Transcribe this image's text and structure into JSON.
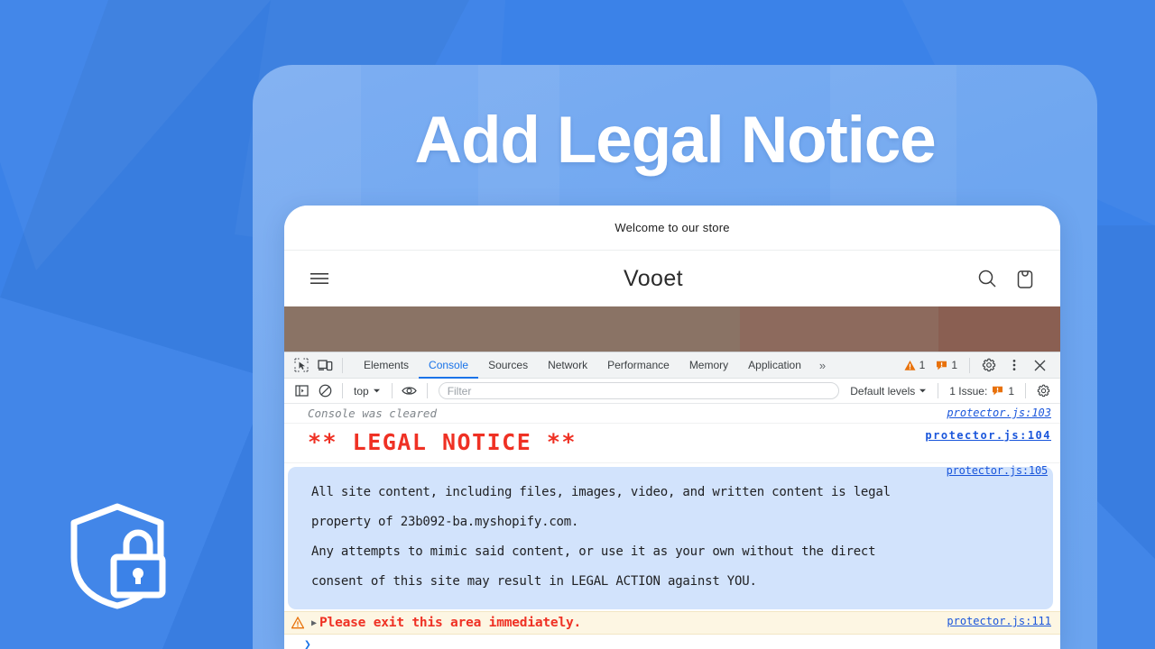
{
  "hero": {
    "title": "Add Legal Notice",
    "badge_icon": "shield-lock-icon"
  },
  "store": {
    "announcement": "Welcome to our store",
    "name": "Vooet",
    "menu_icon": "hamburger-menu-icon",
    "search_icon": "search-icon",
    "cart_icon": "shopping-bag-icon"
  },
  "devtools": {
    "inspect_icon": "inspect-element-icon",
    "device_icon": "device-toolbar-icon",
    "tabs": [
      {
        "label": "Elements",
        "active": false
      },
      {
        "label": "Console",
        "active": true
      },
      {
        "label": "Sources",
        "active": false
      },
      {
        "label": "Network",
        "active": false
      },
      {
        "label": "Performance",
        "active": false
      },
      {
        "label": "Memory",
        "active": false
      },
      {
        "label": "Application",
        "active": false
      }
    ],
    "more_tabs_label": "»",
    "warning_count": "1",
    "error_count": "1",
    "settings_icon": "gear-icon",
    "kebab_icon": "more-options-icon",
    "close_icon": "close-icon",
    "filterbar": {
      "sidebar_icon": "console-sidebar-icon",
      "clear_icon": "clear-console-icon",
      "context_label": "top",
      "eye_icon": "live-expression-icon",
      "filter_placeholder": "Filter",
      "filter_value": "",
      "levels_label": "Default levels",
      "issues_label": "1 Issue:",
      "issues_count": "1",
      "settings_icon": "console-settings-icon"
    },
    "messages": [
      {
        "type": "cleared",
        "text": "Console was cleared",
        "source": "protector.js:103"
      },
      {
        "type": "heading",
        "text": "** LEGAL NOTICE **",
        "source": "protector.js:104"
      },
      {
        "type": "info-block",
        "lines": [
          "All site content, including files, images, video, and written content is legal",
          "property of 23b092-ba.myshopify.com.",
          "Any attempts to mimic said content, or use it as your own without the direct",
          "consent of this site may result in LEGAL ACTION against YOU."
        ],
        "source": "protector.js:105"
      },
      {
        "type": "warning",
        "icon": "warning-triangle-icon",
        "text": "Please exit this area immediately.",
        "source": "protector.js:111"
      }
    ],
    "prompt_symbol": "❯"
  },
  "colors": {
    "accent_blue": "#1a73e8",
    "bg_blue": "#3b82e8",
    "panel_blue": "#6ea6f0",
    "error_red": "#ef3124",
    "warn_orange": "#e8710a",
    "info_bg": "#d2e3fc"
  }
}
